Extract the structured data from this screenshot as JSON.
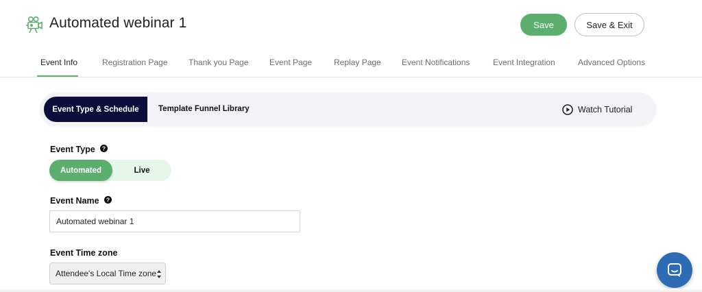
{
  "header": {
    "title": "Automated webinar 1",
    "logo_icon": "camera-icon",
    "save_label": "Save",
    "save_exit_label": "Save & Exit"
  },
  "tabs": [
    {
      "label": "Event Info",
      "active": true
    },
    {
      "label": "Registration Page",
      "active": false
    },
    {
      "label": "Thank you Page",
      "active": false
    },
    {
      "label": "Event Page",
      "active": false
    },
    {
      "label": "Replay Page",
      "active": false
    },
    {
      "label": "Event Notifications",
      "active": false
    },
    {
      "label": "Event Integration",
      "active": false
    },
    {
      "label": "Advanced Options",
      "active": false
    }
  ],
  "subheader": {
    "active_tab": "Event Type & Schedule",
    "other_tab": "Template Funnel Library",
    "watch_tutorial": "Watch Tutorial",
    "watch_icon": "play-circle-icon"
  },
  "form": {
    "event_type": {
      "label": "Event Type",
      "options": [
        "Automated",
        "Live"
      ],
      "selected": "Automated"
    },
    "event_name": {
      "label": "Event Name",
      "value": "Automated webinar 1"
    },
    "timezone": {
      "label": "Event Time zone",
      "selected": "Attendee's Local Time zone"
    }
  },
  "colors": {
    "accent": "#5cae6e",
    "dark": "#0d0d3b",
    "chat": "#2d6cb5"
  },
  "chat_icon": "chat-bubble-icon"
}
